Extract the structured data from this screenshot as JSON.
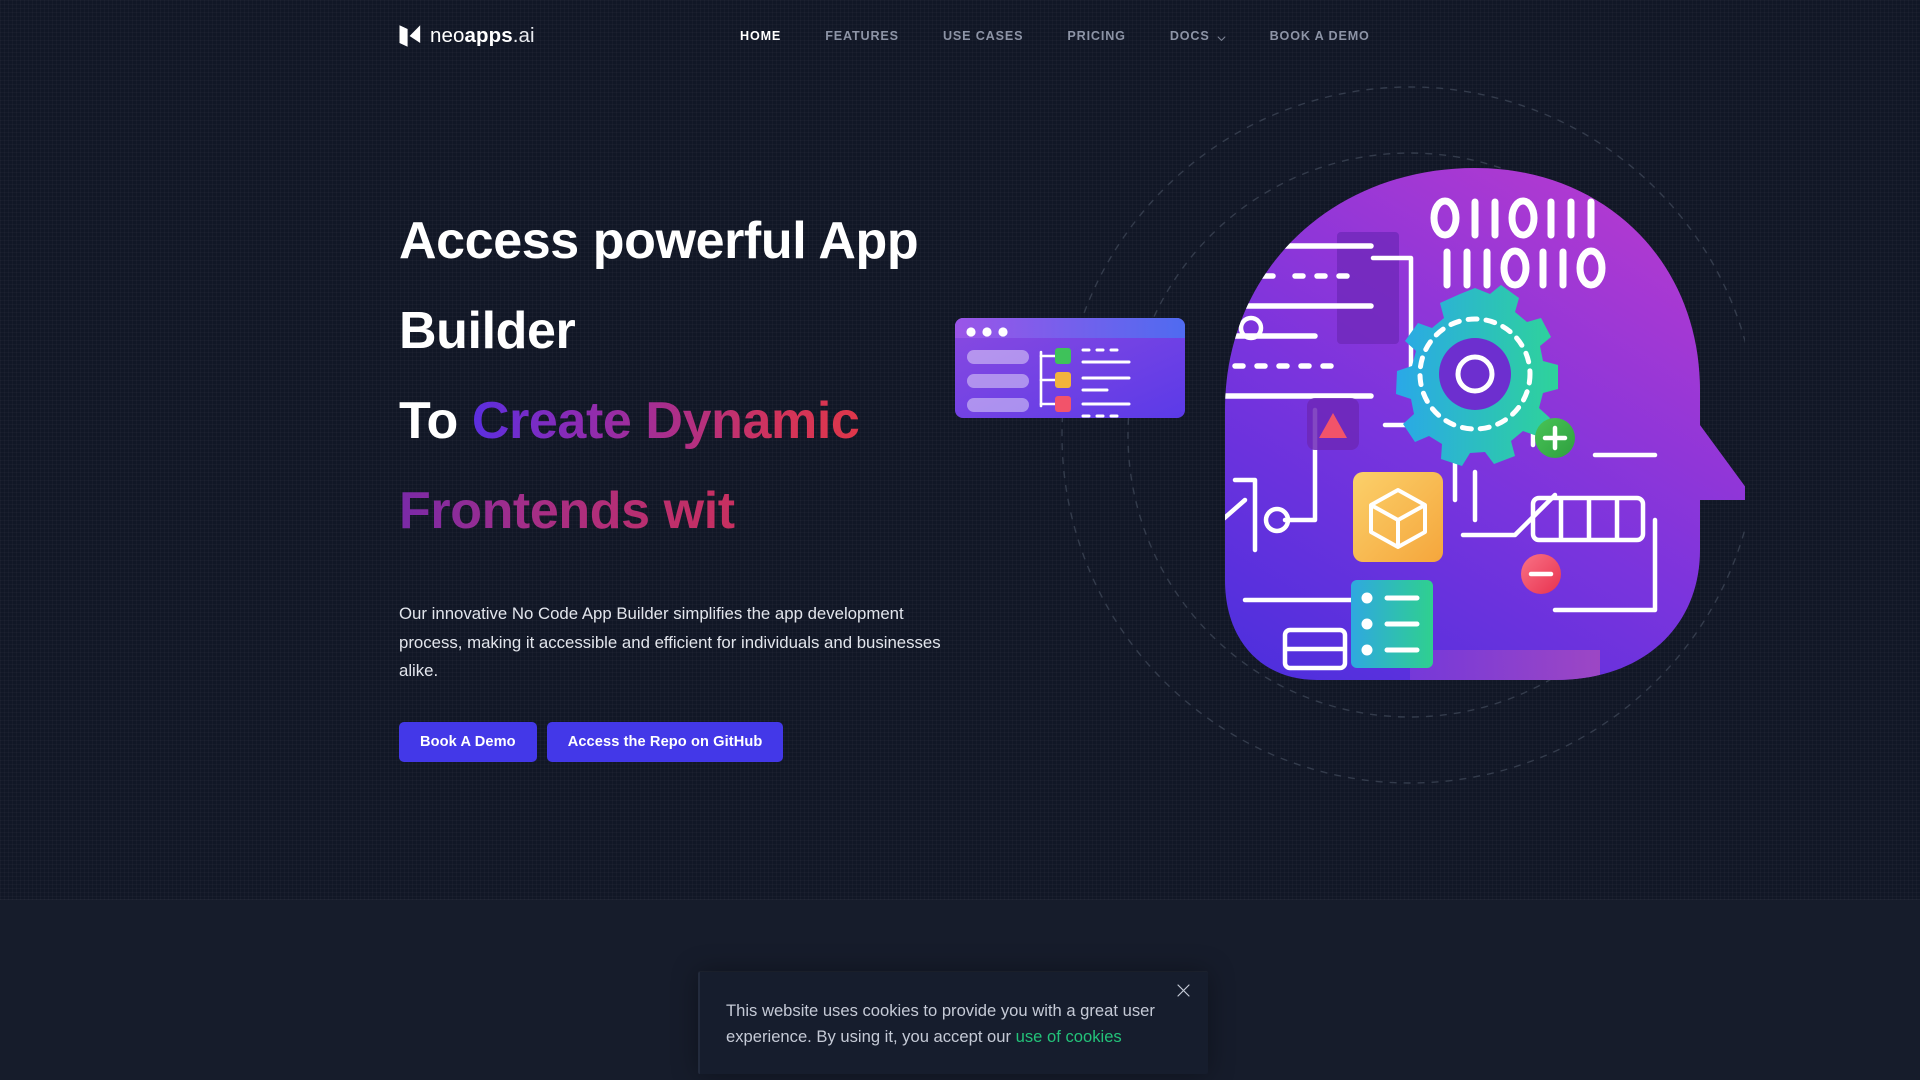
{
  "brand": {
    "logo_icon": "neoapps-logo-mark",
    "name_prefix": "neo",
    "name_bold": "apps",
    "name_tld": ".ai"
  },
  "nav": {
    "items": [
      {
        "label": "HOME",
        "active": true,
        "has_caret": false
      },
      {
        "label": "FEATURES",
        "active": false,
        "has_caret": false
      },
      {
        "label": "USE CASES",
        "active": false,
        "has_caret": false
      },
      {
        "label": "PRICING",
        "active": false,
        "has_caret": false
      },
      {
        "label": "DOCS",
        "active": false,
        "has_caret": true
      },
      {
        "label": "BOOK A DEMO",
        "active": false,
        "has_caret": false
      }
    ]
  },
  "hero": {
    "headline_line1": "Access powerful App",
    "headline_line2": "Builder",
    "headline_line3_static": "To ",
    "headline_line3_gradient": "Create Dynamic",
    "headline_line4_gradient": "Frontends wit",
    "paragraph": "Our innovative No Code App Builder simplifies the app development process, making it accessible and efficient for individuals and businesses alike.",
    "primary_button": "Book A Demo",
    "secondary_button": "Access the Repo on GitHub",
    "illustration": {
      "name": "ai-head-app-builder-illustration",
      "binary_line1": "OIIOIII",
      "binary_line2": "IIIOIIO",
      "head_gradient_from": "#b43ad0",
      "head_gradient_to": "#4f2fdd",
      "gear_gradient_from": "#2aa8e8",
      "gear_gradient_to": "#2ed39a",
      "cube_gradient_from": "#fbd06a",
      "cube_gradient_to": "#f5a63c",
      "server_gradient_from": "#2fa8e0",
      "server_gradient_to": "#2fd08f",
      "plus_badge_color": "#34b44a",
      "minus_badge_color": "#f2536a",
      "triangle_badge_color": "#f2536a",
      "window_bar_color": "#4f6bf0"
    }
  },
  "cookie_banner": {
    "text_part1": "This website uses cookies to provide you with a great user experience. By using it, you accept our ",
    "link_label": "use of cookies",
    "close_icon": "close-icon",
    "link_color": "#23c279"
  },
  "theme": {
    "page_background": "#111726",
    "lower_background": "#161c2b",
    "accent_button": "#4338e8",
    "nav_inactive": "#8d94a6",
    "nav_active": "#ffffff"
  }
}
